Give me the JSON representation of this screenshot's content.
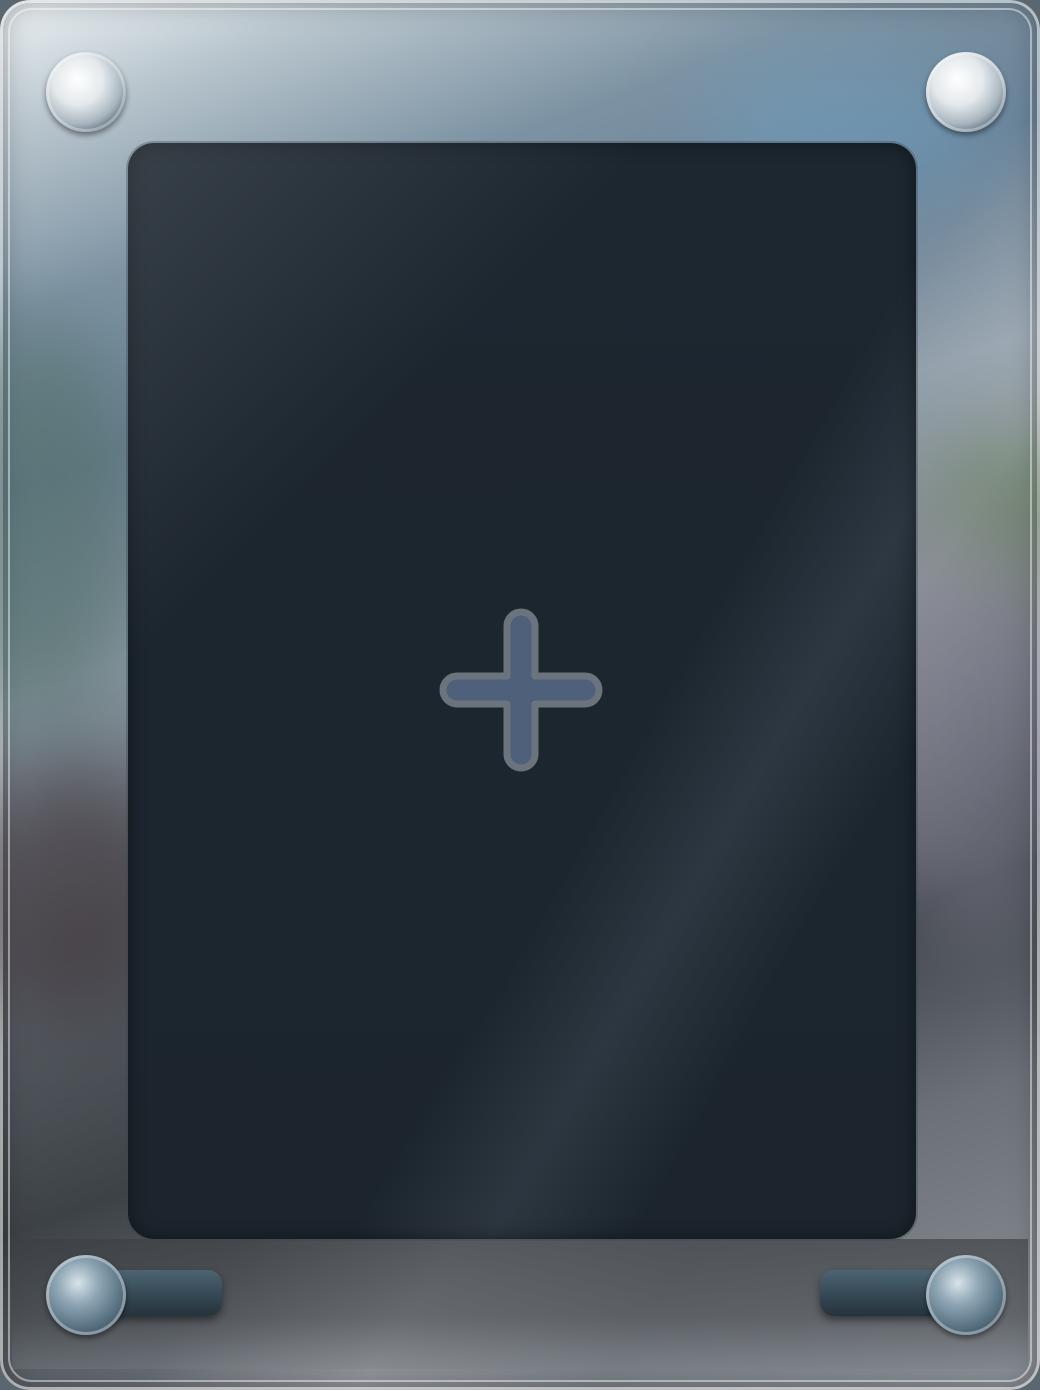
{
  "card_frame": {
    "slot": {
      "state": "empty",
      "action_icon": "plus-icon"
    },
    "bolts": [
      "bolt-icon",
      "bolt-icon",
      "bolt-icon",
      "bolt-icon"
    ],
    "colors": {
      "slot_fill": "#1c252d",
      "plus_fill": "#4f607a",
      "plus_outline": "#6b737d",
      "frame_highlight": "#eef3f6"
    }
  }
}
